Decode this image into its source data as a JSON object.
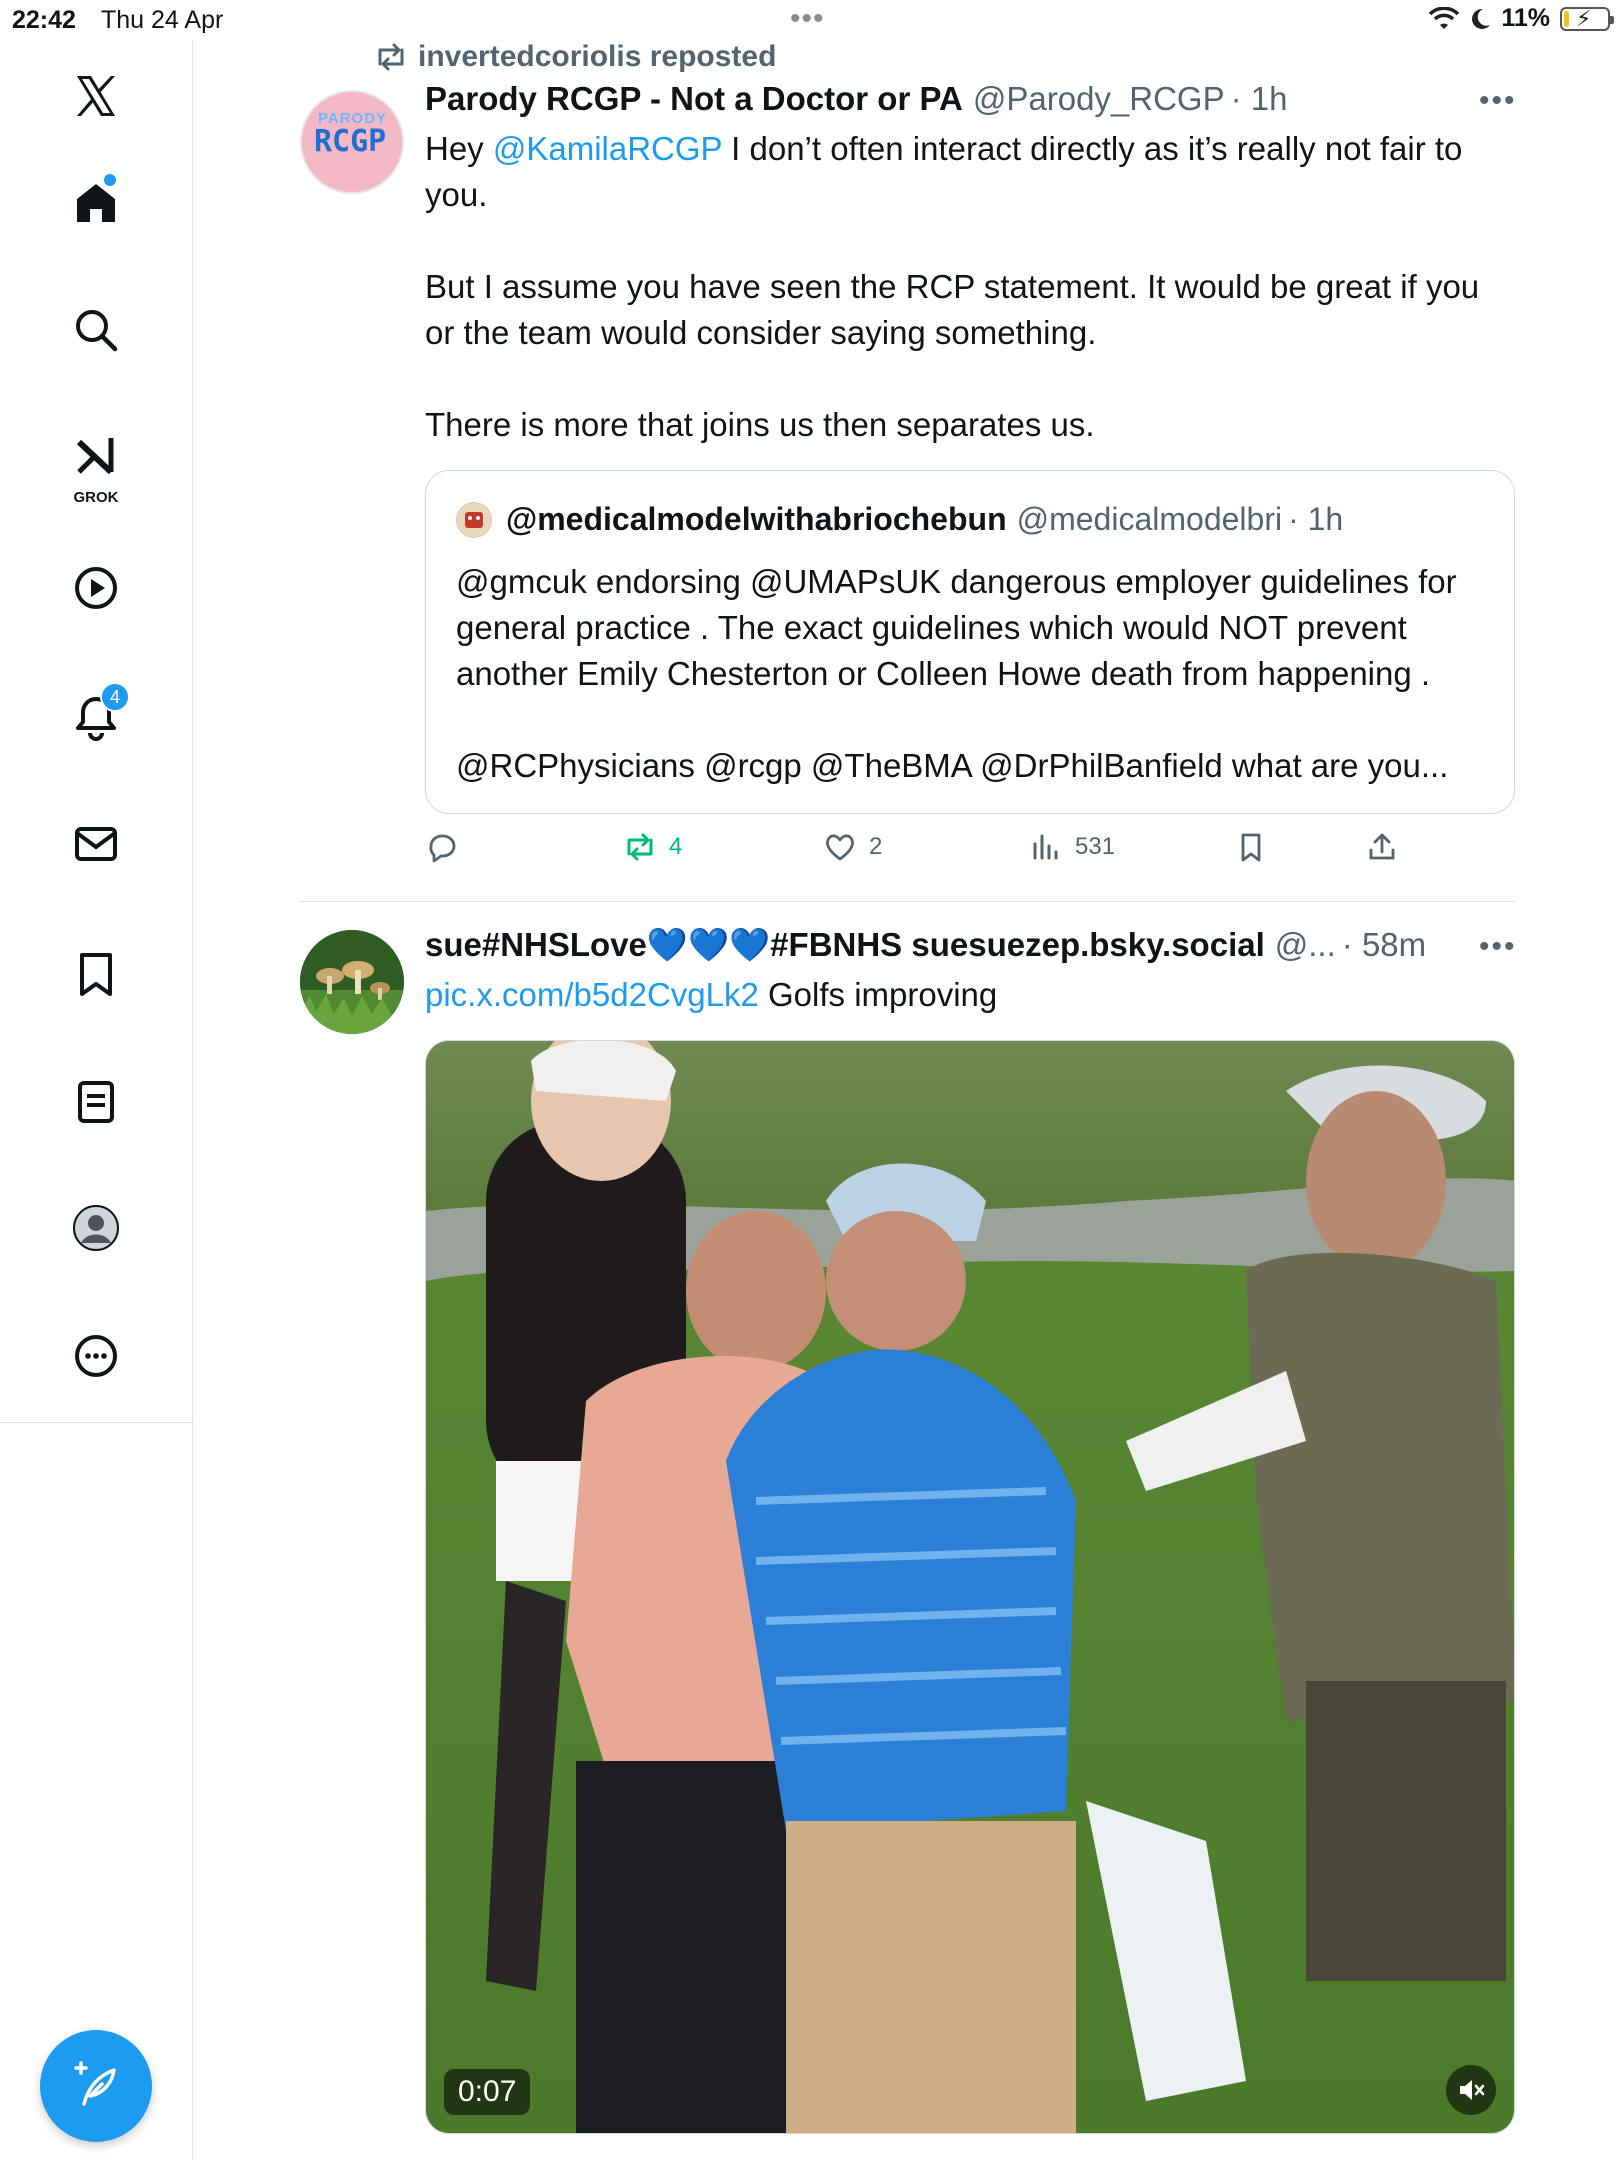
{
  "status_bar": {
    "time": "22:42",
    "date": "Thu 24 Apr",
    "battery": "11%",
    "battery_level": 0.11
  },
  "sidebar": {
    "items": [
      {
        "name": "x-logo",
        "icon": "x-logo-icon"
      },
      {
        "name": "home",
        "icon": "home-icon",
        "dot": true
      },
      {
        "name": "search",
        "icon": "search-icon"
      },
      {
        "name": "grok",
        "icon": "grok-icon",
        "label": "GROK"
      },
      {
        "name": "video",
        "icon": "play-circle-icon"
      },
      {
        "name": "notifications",
        "icon": "bell-icon",
        "badge": "4"
      },
      {
        "name": "messages",
        "icon": "envelope-icon"
      },
      {
        "name": "bookmarks",
        "icon": "bookmark-icon"
      },
      {
        "name": "lists",
        "icon": "list-icon"
      },
      {
        "name": "profile",
        "icon": "avatar-icon"
      },
      {
        "name": "more",
        "icon": "more-circle-icon"
      }
    ],
    "compose_icon": "compose-feather-icon"
  },
  "tweets": [
    {
      "repost_label": "invertedcoriolis reposted",
      "name": "Parody RCGP - Not a Doctor or PA",
      "handle": "@Parody_RCGP",
      "time": "· 1h",
      "avatar_top": "PARODY",
      "avatar_bottom": "RCGP",
      "text_mention": "@KamilaRCGP",
      "text_p1_pre": "Hey ",
      "text_p1_post": " I don’t often interact directly as it’s really not fair to you.",
      "text_p2": "But I assume you have seen the RCP statement. It would be great if you or the team would consider saying something.",
      "text_p3": "There is more that joins us then separates us.",
      "quote": {
        "name": "@medicalmodelwithabriochebun",
        "handle": "@medicalmodelbri",
        "time": "· 1h",
        "text_p1": "@gmcuk endorsing @UMAPsUK dangerous employer guidelines for general practice . The exact guidelines which would NOT prevent another Emily Chesterton or Colleen Howe death from happening .",
        "text_p2": "@RCPhysicians @rcgp @TheBMA @DrPhilBanfield what are you..."
      },
      "actions": {
        "reply": "",
        "reposts": "4",
        "likes": "2",
        "views": "531",
        "reposted_color": "#00ba7c"
      }
    },
    {
      "name": "sue#NHSLove💙💙💙#FBNHS suesuezep.bsky.social",
      "handle": "@...",
      "time": "· 58m",
      "link": "pic.x.com/b5d2CvgLk2",
      "text": " Golfs improving",
      "duration": "0:07",
      "mute_icon": "speaker-muted-icon"
    }
  ]
}
